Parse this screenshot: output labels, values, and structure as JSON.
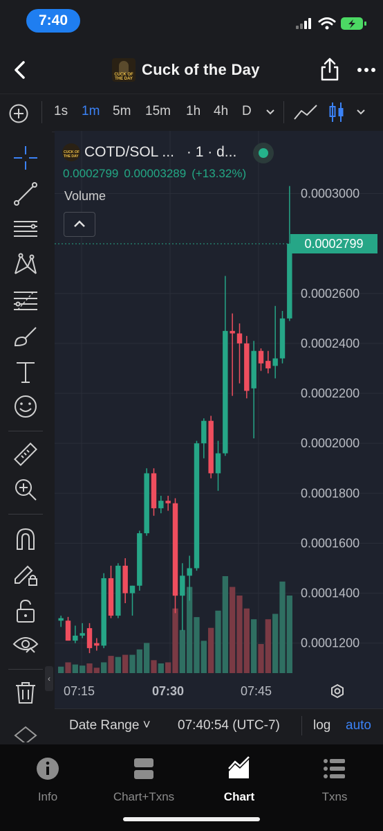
{
  "status_bar": {
    "time": "7:40"
  },
  "header": {
    "title": "Cuck of the Day",
    "logo_text": "CUCK OF THE DAY"
  },
  "toolbar": {
    "timeframes": [
      "1s",
      "1m",
      "5m",
      "15m",
      "1h",
      "4h",
      "D"
    ],
    "active_timeframe": "1m"
  },
  "chart": {
    "symbol": "COTD/SOL ...",
    "interval": "· 1 · d...",
    "quote_price": "0.0002799",
    "quote_change": "0.00003289",
    "quote_pct": "(+13.32%)",
    "volume_label": "Volume",
    "price_tag": "0.0002799",
    "colors": {
      "up": "#26a687",
      "down": "#ef4e5e",
      "vol_up": "#2f6f62",
      "vol_down": "#7a3a44",
      "background": "#1e222d"
    }
  },
  "chart_data": {
    "type": "candlestick",
    "y_ticks": [
      "0.0003000",
      "0.0002600",
      "0.0002400",
      "0.0002200",
      "0.0002000",
      "0.0001800",
      "0.0001600",
      "0.0001400",
      "0.0001200"
    ],
    "x_ticks": [
      "07:15",
      "07:30",
      "07:45"
    ],
    "ylim": [
      0.000108,
      0.000314
    ],
    "candles": [
      {
        "o": 0.000129,
        "h": 0.000131,
        "l": 0.0001265,
        "c": 0.00013
      },
      {
        "o": 0.000129,
        "h": 0.0001305,
        "l": 0.000121,
        "c": 0.000121
      },
      {
        "o": 0.000121,
        "h": 0.000127,
        "l": 0.00012,
        "c": 0.000123
      },
      {
        "o": 0.000123,
        "h": 0.000128,
        "l": 0.000122,
        "c": 0.000124
      },
      {
        "o": 0.000126,
        "h": 0.000128,
        "l": 0.000116,
        "c": 0.000118
      },
      {
        "o": 0.00012,
        "h": 0.000122,
        "l": 0.000117,
        "c": 0.000119
      },
      {
        "o": 0.000119,
        "h": 0.000148,
        "l": 0.000118,
        "c": 0.000146
      },
      {
        "o": 0.000146,
        "h": 0.000151,
        "l": 0.00013,
        "c": 0.000131
      },
      {
        "o": 0.000131,
        "h": 0.000152,
        "l": 0.00013,
        "c": 0.000151
      },
      {
        "o": 0.000151,
        "h": 0.000154,
        "l": 0.000136,
        "c": 0.00014
      },
      {
        "o": 0.00014,
        "h": 0.000143,
        "l": 0.000131,
        "c": 0.000143
      },
      {
        "o": 0.000143,
        "h": 0.000165,
        "l": 0.000141,
        "c": 0.000164
      },
      {
        "o": 0.000164,
        "h": 0.00019,
        "l": 0.000163,
        "c": 0.000188
      },
      {
        "o": 0.000188,
        "h": 0.00019,
        "l": 0.000171,
        "c": 0.000174
      },
      {
        "o": 0.000174,
        "h": 0.000179,
        "l": 0.000172,
        "c": 0.000177
      },
      {
        "o": 0.000177,
        "h": 0.000179,
        "l": 0.000173,
        "c": 0.000176
      },
      {
        "o": 0.000176,
        "h": 0.000178,
        "l": 0.000132,
        "c": 0.000139
      },
      {
        "o": 0.000139,
        "h": 0.000152,
        "l": 0.000125,
        "c": 0.000147
      },
      {
        "o": 0.000147,
        "h": 0.000155,
        "l": 0.000137,
        "c": 0.00015
      },
      {
        "o": 0.00015,
        "h": 0.000201,
        "l": 0.000149,
        "c": 0.0002
      },
      {
        "o": 0.0002,
        "h": 0.00021,
        "l": 0.000194,
        "c": 0.000209
      },
      {
        "o": 0.000209,
        "h": 0.000211,
        "l": 0.000186,
        "c": 0.000188
      },
      {
        "o": 0.000188,
        "h": 0.000201,
        "l": 0.000181,
        "c": 0.000196
      },
      {
        "o": 0.000196,
        "h": 0.000267,
        "l": 0.000195,
        "c": 0.000245
      },
      {
        "o": 0.000245,
        "h": 0.000252,
        "l": 0.000219,
        "c": 0.000244
      },
      {
        "o": 0.000244,
        "h": 0.000248,
        "l": 0.000224,
        "c": 0.00024
      },
      {
        "o": 0.00024,
        "h": 0.000243,
        "l": 0.000218,
        "c": 0.000221
      },
      {
        "o": 0.000222,
        "h": 0.000241,
        "l": 0.000202,
        "c": 0.000237
      },
      {
        "o": 0.000237,
        "h": 0.000238,
        "l": 0.000229,
        "c": 0.000232
      },
      {
        "o": 0.000233,
        "h": 0.000237,
        "l": 0.000228,
        "c": 0.00023
      },
      {
        "o": 0.000231,
        "h": 0.000255,
        "l": 0.000226,
        "c": 0.000234
      },
      {
        "o": 0.000234,
        "h": 0.000253,
        "l": 0.000232,
        "c": 0.00025
      },
      {
        "o": 0.00025,
        "h": 0.000303,
        "l": 0.000249,
        "c": 0.0002799
      }
    ],
    "volumes": [
      6,
      10,
      8,
      7,
      9,
      5,
      10,
      16,
      15,
      17,
      17,
      22,
      28,
      12,
      9,
      10,
      60,
      40,
      80,
      52,
      30,
      42,
      58,
      90,
      80,
      72,
      60,
      50,
      27,
      50,
      55,
      85,
      72
    ]
  },
  "date_bar": {
    "date_range": "Date Range ˅",
    "clock": "07:40:54 (UTC-7)",
    "log": "log",
    "auto": "auto"
  },
  "tabs": [
    {
      "label": "Info",
      "icon": "info-icon"
    },
    {
      "label": "Chart+Txns",
      "icon": "split-view-icon"
    },
    {
      "label": "Chart",
      "icon": "area-chart-icon"
    },
    {
      "label": "Txns",
      "icon": "list-icon"
    }
  ]
}
